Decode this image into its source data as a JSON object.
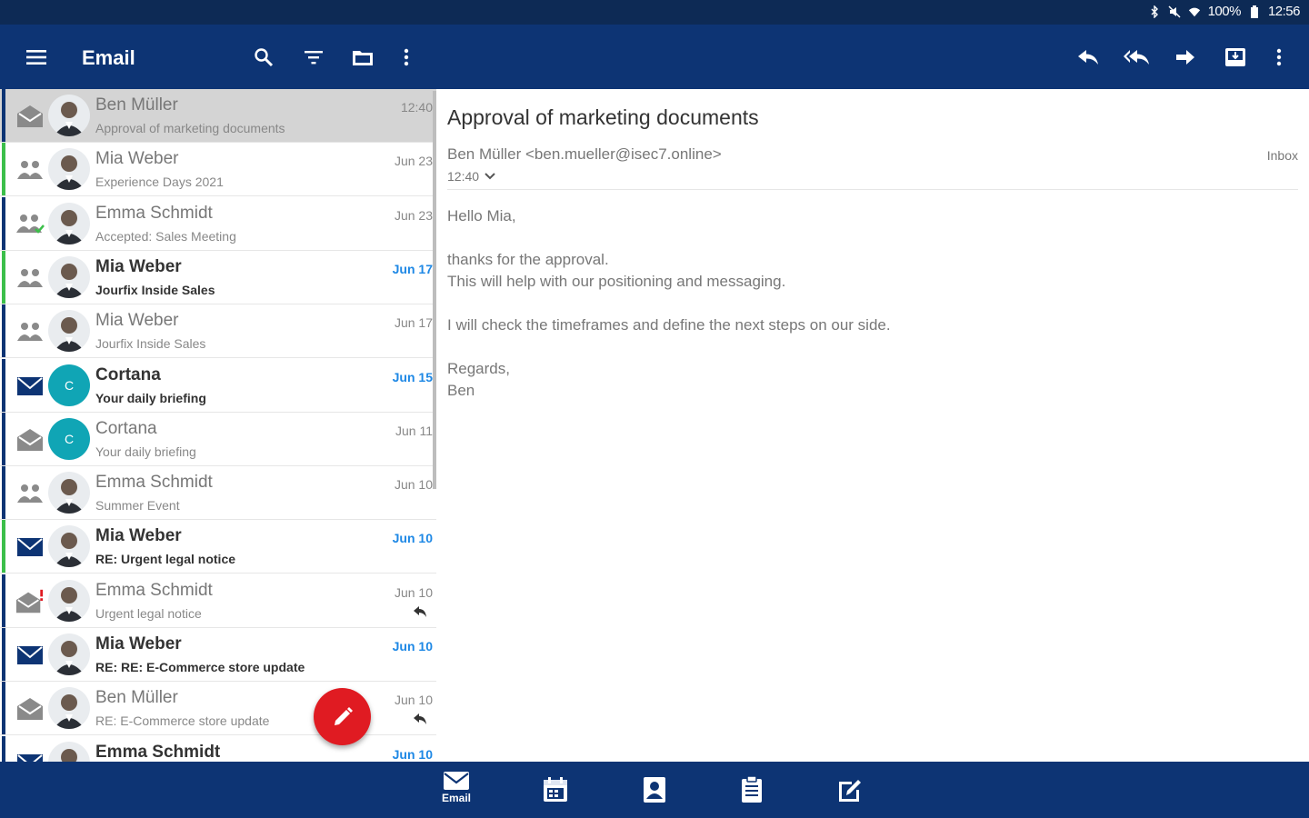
{
  "status_bar": {
    "battery": "100%",
    "time": "12:56"
  },
  "app_bar": {
    "title": "Email"
  },
  "colors": {
    "primary": "#0d3474",
    "status_bar": "#0d2a55",
    "unread_date": "#1e88e5",
    "fab": "#e01b22",
    "cortana_avatar": "#10a5b5",
    "row_bar_blue": "#0d3474",
    "row_bar_green": "#3cbf4a"
  },
  "messages": [
    {
      "sender": "Ben Müller",
      "subject": "Approval of marketing documents",
      "date": "12:40",
      "type_icon": "envelope-open-icon",
      "avatar": "photo",
      "avatar_initial": "",
      "unread": false,
      "selected": true,
      "replied": false,
      "bar": "blue"
    },
    {
      "sender": "Mia Weber",
      "subject": "Experience Days 2021",
      "date": "Jun 23",
      "type_icon": "meeting-icon",
      "avatar": "photo",
      "avatar_initial": "",
      "unread": false,
      "selected": false,
      "replied": false,
      "bar": "green"
    },
    {
      "sender": "Emma Schmidt",
      "subject": "Accepted: Sales Meeting",
      "date": "Jun 23",
      "type_icon": "meeting-accepted-icon",
      "avatar": "photo",
      "avatar_initial": "",
      "unread": false,
      "selected": false,
      "replied": false,
      "bar": "blue"
    },
    {
      "sender": "Mia Weber",
      "subject": "Jourfix Inside Sales",
      "date": "Jun 17",
      "type_icon": "meeting-icon",
      "avatar": "photo",
      "avatar_initial": "",
      "unread": true,
      "selected": false,
      "replied": false,
      "bar": "green"
    },
    {
      "sender": "Mia Weber",
      "subject": "Jourfix Inside Sales",
      "date": "Jun 17",
      "type_icon": "meeting-icon",
      "avatar": "photo",
      "avatar_initial": "",
      "unread": false,
      "selected": false,
      "replied": false,
      "bar": "blue"
    },
    {
      "sender": "Cortana",
      "subject": "Your daily briefing",
      "date": "Jun 15",
      "type_icon": "envelope-icon",
      "avatar": "initial",
      "avatar_initial": "C",
      "unread": true,
      "selected": false,
      "replied": false,
      "bar": "blue"
    },
    {
      "sender": "Cortana",
      "subject": "Your daily briefing",
      "date": "Jun 11",
      "type_icon": "envelope-open-icon",
      "avatar": "initial",
      "avatar_initial": "C",
      "unread": false,
      "selected": false,
      "replied": false,
      "bar": "blue"
    },
    {
      "sender": "Emma Schmidt",
      "subject": "Summer Event",
      "date": "Jun 10",
      "type_icon": "meeting-icon",
      "avatar": "photo",
      "avatar_initial": "",
      "unread": false,
      "selected": false,
      "replied": false,
      "bar": "blue"
    },
    {
      "sender": "Mia Weber",
      "subject": "RE: Urgent legal notice",
      "date": "Jun 10",
      "type_icon": "envelope-icon",
      "avatar": "photo",
      "avatar_initial": "",
      "unread": true,
      "selected": false,
      "replied": false,
      "bar": "green"
    },
    {
      "sender": "Emma Schmidt",
      "subject": "Urgent legal notice",
      "date": "Jun 10",
      "type_icon": "envelope-open-important-icon",
      "avatar": "photo",
      "avatar_initial": "",
      "unread": false,
      "selected": false,
      "replied": true,
      "bar": "blue"
    },
    {
      "sender": "Mia Weber",
      "subject": "RE: RE: E-Commerce store update",
      "date": "Jun 10",
      "type_icon": "envelope-icon",
      "avatar": "photo",
      "avatar_initial": "",
      "unread": true,
      "selected": false,
      "replied": false,
      "bar": "blue"
    },
    {
      "sender": "Ben Müller",
      "subject": "RE: E-Commerce store update",
      "date": "Jun 10",
      "type_icon": "envelope-open-icon",
      "avatar": "photo",
      "avatar_initial": "",
      "unread": false,
      "selected": false,
      "replied": true,
      "bar": "blue"
    },
    {
      "sender": "Emma Schmidt",
      "subject": "",
      "date": "Jun 10",
      "type_icon": "envelope-icon",
      "avatar": "photo",
      "avatar_initial": "",
      "unread": true,
      "selected": false,
      "replied": false,
      "bar": "blue"
    }
  ],
  "reader": {
    "subject": "Approval of marketing documents",
    "from": "Ben Müller <ben.mueller@isec7.online>",
    "time": "12:40",
    "folder": "Inbox",
    "greeting": "Hello Mia,",
    "line1": "thanks for the approval.",
    "line2": "This will help with our positioning and messaging.",
    "line3": "I will check the timeframes and define the next steps on our side.",
    "sign1": "Regards,",
    "sign2": "Ben"
  },
  "bottom_nav": {
    "email_label": "Email",
    "items": [
      "envelope-icon",
      "calendar-icon",
      "contacts-icon",
      "tasks-icon",
      "notes-icon"
    ]
  }
}
